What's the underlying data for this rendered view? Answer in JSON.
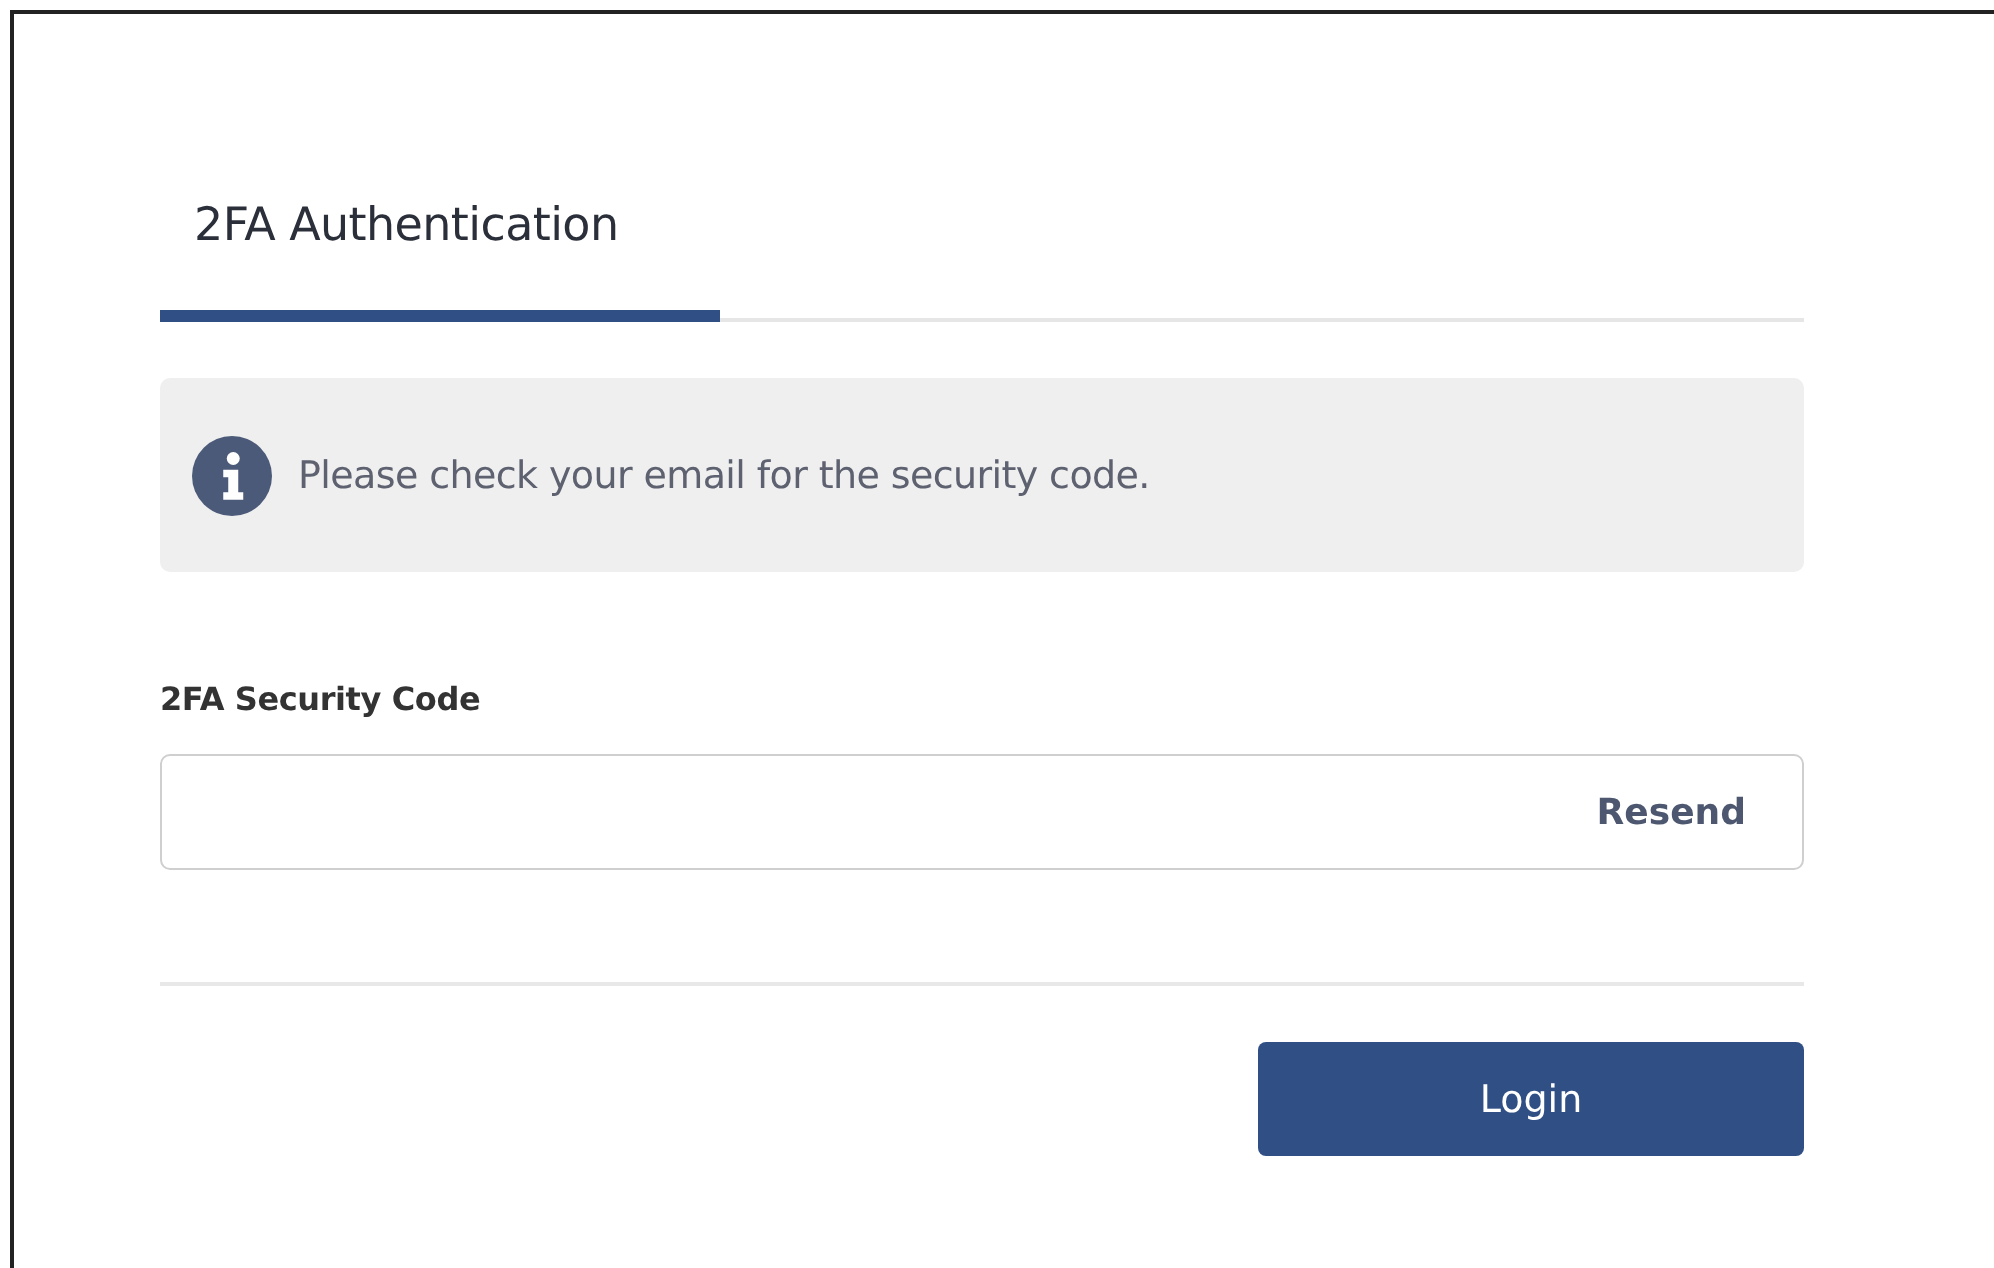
{
  "tabs": [
    {
      "label": "2FA Authentication",
      "selected": true
    }
  ],
  "notice": {
    "kind": "info",
    "text": "Please check your email for the security code."
  },
  "security_code": {
    "label": "2FA Security Code",
    "action": "Resend"
  },
  "buttons": [
    "Login"
  ]
}
